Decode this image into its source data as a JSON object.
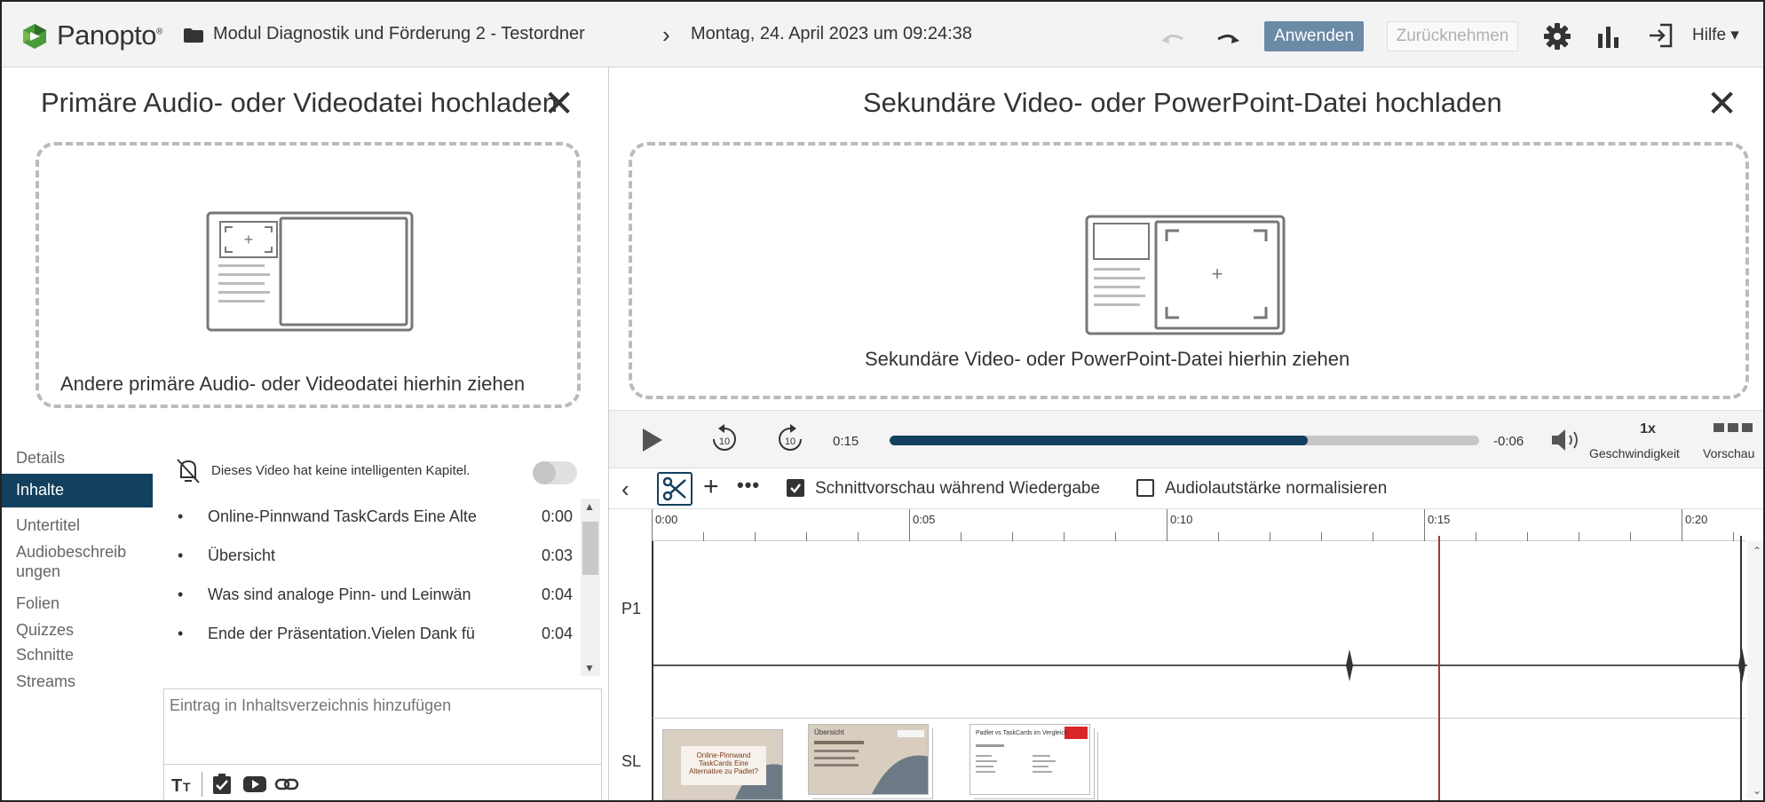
{
  "header": {
    "brand": "Panopto",
    "folder": "Modul Diagnostik und Förderung 2 - Testordner",
    "separator": "›",
    "session_date": "Montag, 24. April 2023 um 09:24:38",
    "apply_label": "Anwenden",
    "revert_label": "Zurücknehmen",
    "help_label": "Hilfe ▾",
    "accent": "#13405e"
  },
  "primary_upload": {
    "title": "Primäre Audio- oder Videodatei hochladen",
    "drop_label": "Andere primäre Audio- oder Videodatei hierhin ziehen",
    "close": "✕"
  },
  "secondary_upload": {
    "title": "Sekundäre Video- oder PowerPoint-Datei hochladen",
    "drop_label": "Sekundäre Video- oder PowerPoint-Datei hierhin ziehen",
    "close": "✕"
  },
  "player": {
    "rewind_label": "10",
    "forward_label": "10",
    "current_time": "0:15",
    "remaining_time": "-0:06",
    "progress": 0.71,
    "speed_value": "1x",
    "speed_label": "Geschwindigkeit",
    "preview_label": "Vorschau"
  },
  "nav": {
    "items": [
      "Details",
      "Inhalte",
      "Untertitel",
      "Audiobeschreib",
      "ungen",
      "Folien",
      "Quizzes",
      "Schnitte",
      "Streams"
    ],
    "active": "Inhalte"
  },
  "contents": {
    "no_chapters_text": "Dieses Video hat keine intelligenten Kapitel.",
    "items": [
      {
        "title": "Online-Pinnwand TaskCards Eine Alte",
        "time": "0:00"
      },
      {
        "title": "Übersicht",
        "time": "0:03"
      },
      {
        "title": "Was sind analoge Pinn- und Leinwän",
        "time": "0:04"
      },
      {
        "title": "Ende der Präsentation.Vielen Dank fü",
        "time": "0:04"
      }
    ],
    "input_placeholder": "Eintrag in Inhaltsverzeichnis hinzufügen"
  },
  "editor": {
    "back": "‹",
    "add": "+",
    "more": "•••",
    "cut_preview_label": "Schnittvorschau während Wiedergabe",
    "cut_preview_checked": true,
    "normalize_label": "Audiolautstärke normalisieren",
    "normalize_checked": false
  },
  "timeline": {
    "ruler_labels": [
      "0:00",
      "0:05",
      "0:10",
      "0:15",
      "0:20"
    ],
    "tracks": [
      "P1",
      "SL"
    ],
    "slides": [
      {
        "title": "Online-Pinnwand TaskCards Eine Alternative zu Padlet?"
      },
      {
        "title": "Übersicht"
      },
      {
        "title": "Padlet vs TaskCards im Vergleich"
      }
    ]
  }
}
